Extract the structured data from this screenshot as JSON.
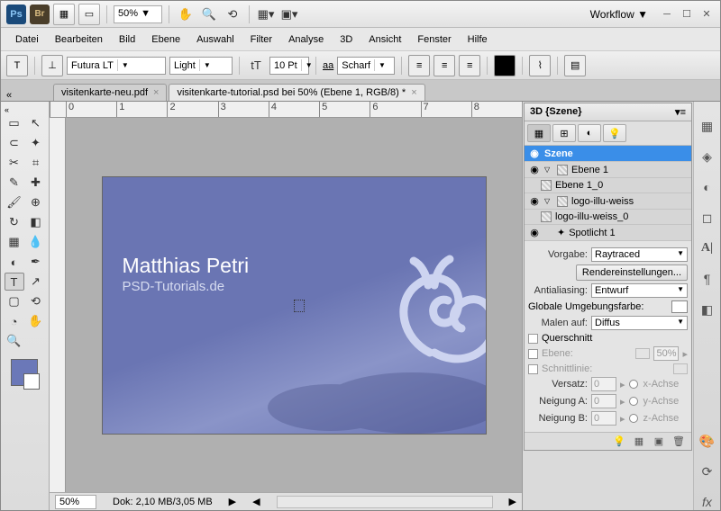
{
  "topbar": {
    "zoom": "50%",
    "workflow": "Workflow ▼"
  },
  "menu": [
    "Datei",
    "Bearbeiten",
    "Bild",
    "Ebene",
    "Auswahl",
    "Filter",
    "Analyse",
    "3D",
    "Ansicht",
    "Fenster",
    "Hilfe"
  ],
  "options": {
    "font_family": "Futura LT",
    "font_weight": "Light",
    "font_size": "10 Pt",
    "aa_label": "aa",
    "aa_mode": "Scharf"
  },
  "tabs": [
    {
      "label": "visitenkarte-neu.pdf",
      "active": false
    },
    {
      "label": "visitenkarte-tutorial.psd bei 50% (Ebene 1, RGB/8) *",
      "active": true
    }
  ],
  "ruler": [
    "0",
    "1",
    "2",
    "3",
    "4",
    "5",
    "6",
    "7",
    "8"
  ],
  "card": {
    "title": "Matthias Petri",
    "subtitle": "PSD-Tutorials.de"
  },
  "status": {
    "zoom": "50%",
    "doc": "Dok: 2,10 MB/3,05 MB"
  },
  "panel3d": {
    "title": "3D {Szene}",
    "scene_header": "Szene",
    "rows": [
      {
        "indent": 1,
        "expand": true,
        "label": "Ebene 1",
        "mesh": true
      },
      {
        "indent": 2,
        "expand": false,
        "label": "Ebene 1_0",
        "mesh": true
      },
      {
        "indent": 1,
        "expand": true,
        "label": "logo-illu-weiss",
        "mesh": true
      },
      {
        "indent": 2,
        "expand": false,
        "label": "logo-illu-weiss_0",
        "mesh": true
      },
      {
        "indent": 1,
        "expand": false,
        "label": "Spotlicht 1",
        "light": true
      }
    ],
    "props": {
      "vorgabe_label": "Vorgabe:",
      "vorgabe_value": "Raytraced",
      "render_btn": "Rendereinstellungen...",
      "aa_label": "Antialiasing:",
      "aa_value": "Entwurf",
      "globale_label": "Globale Umgebungsfarbe:",
      "malen_label": "Malen auf:",
      "malen_value": "Diffus",
      "querschnitt": "Querschnitt",
      "ebene_label": "Ebene:",
      "ebene_pct": "50%",
      "schnitt_label": "Schnittlinie:",
      "versatz_label": "Versatz:",
      "versatz_val": "0",
      "neigA_label": "Neigung A:",
      "neigA_val": "0",
      "neigB_label": "Neigung B:",
      "neigB_val": "0",
      "x_achse": "x-Achse",
      "y_achse": "y-Achse",
      "z_achse": "z-Achse"
    }
  }
}
